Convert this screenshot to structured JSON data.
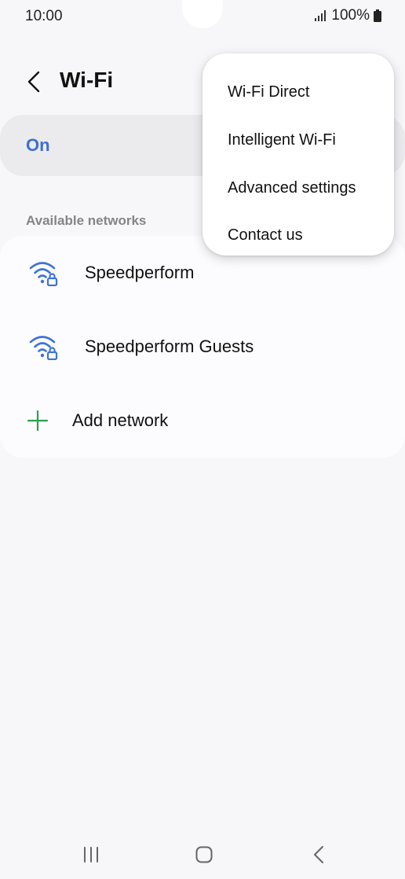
{
  "status_bar": {
    "time": "10:00",
    "battery": "100%"
  },
  "header": {
    "title": "Wi-Fi"
  },
  "toggle": {
    "label": "On",
    "accent": "#3e6fd1"
  },
  "networks": {
    "section_title": "Available networks",
    "items": [
      {
        "name": "Speedperform",
        "icon": "wifi-lock-icon"
      },
      {
        "name": "Speedperform Guests",
        "icon": "wifi-lock-icon"
      }
    ],
    "add_label": "Add network",
    "add_color": "#2aa14f"
  },
  "menu": {
    "items": [
      {
        "label": "Wi-Fi Direct"
      },
      {
        "label": "Intelligent Wi-Fi"
      },
      {
        "label": "Advanced settings"
      },
      {
        "label": "Contact us"
      }
    ]
  }
}
